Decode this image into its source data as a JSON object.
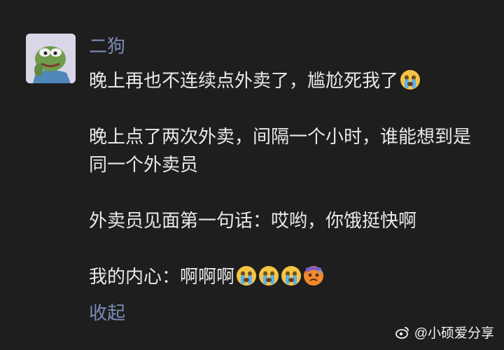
{
  "post": {
    "author": "二狗",
    "paragraphs": [
      {
        "text": "晚上再也不连续点外卖了，尴尬死我了",
        "emojis": [
          "crying-face"
        ]
      },
      {
        "text": "晚上点了两次外卖，间隔一个小时，谁能想到是同一个外卖员",
        "emojis": []
      },
      {
        "text": "外卖员见面第一句话：哎哟，你饿挺快啊",
        "emojis": []
      },
      {
        "text": "我的内心：啊啊啊",
        "emojis": [
          "crying-face",
          "crying-face",
          "crying-face",
          "anxious-sweat-face"
        ]
      }
    ],
    "collapse_label": "收起"
  },
  "watermark": {
    "text": "@小硕爱分享"
  },
  "colors": {
    "background": "#1e1e1e",
    "text": "#e9e9e9",
    "accent": "#7b8cb6"
  }
}
